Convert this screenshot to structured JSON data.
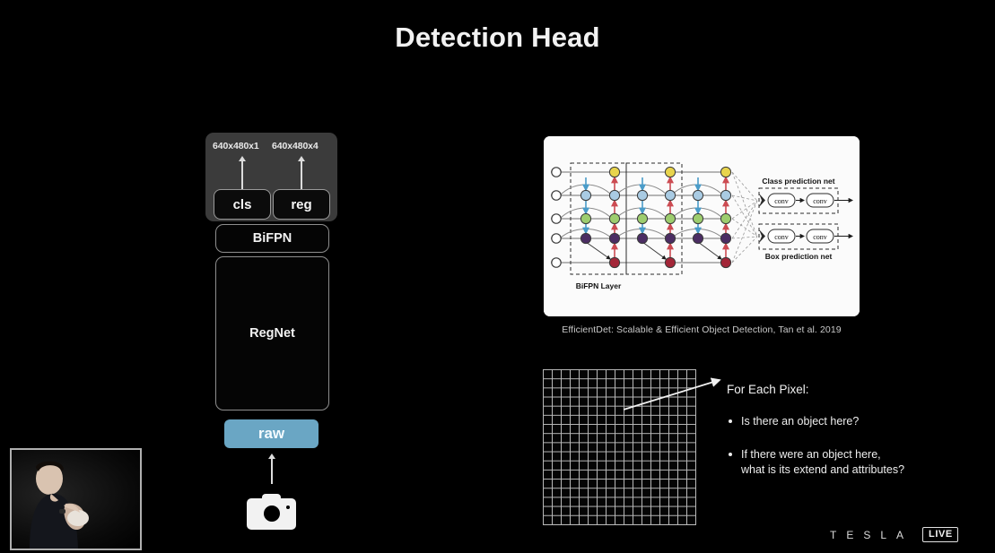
{
  "slide": {
    "title": "Detection Head",
    "background_color": "#000000"
  },
  "network_stack": {
    "output_dims": [
      {
        "label": "640x480x1",
        "for": "cls"
      },
      {
        "label": "640x480x4",
        "for": "reg"
      }
    ],
    "heads": [
      {
        "label": "cls"
      },
      {
        "label": "reg"
      }
    ],
    "neck": {
      "label": "BiFPN"
    },
    "backbone": {
      "label": "RegNet"
    },
    "input": {
      "label": "raw",
      "color": "#6aa6c4"
    },
    "sensor_icon": "camera-icon"
  },
  "figure": {
    "caption": "EfficientDet: Scalable & Efficient Object Detection, Tan et al. 2019",
    "bifpn_layer_label": "BiFPN Layer",
    "class_net_label": "Class prediction net",
    "box_net_label": "Box prediction net",
    "conv_label": "conv",
    "node_colors": {
      "level1": "#e8d44d",
      "level2": "#a9cbe3",
      "level3": "#9dcd6e",
      "level4": "#4b2d63",
      "level5": "#a32638",
      "input": "#ffffff",
      "down_arrow": "#4a9cc9",
      "up_arrow": "#cc4b52"
    }
  },
  "pixel_panel": {
    "grid": {
      "columns": 17,
      "rows": 17,
      "line_color": "#b9b9b9"
    },
    "heading": "For Each Pixel:",
    "bullets": [
      "Is there an object here?",
      "If there were an object here,\nwhat is its extend and attributes?"
    ]
  },
  "speaker_video": {
    "present": true,
    "description": "presenter"
  },
  "branding": {
    "wordmark": "TESLA",
    "live_badge": "LIVE"
  }
}
